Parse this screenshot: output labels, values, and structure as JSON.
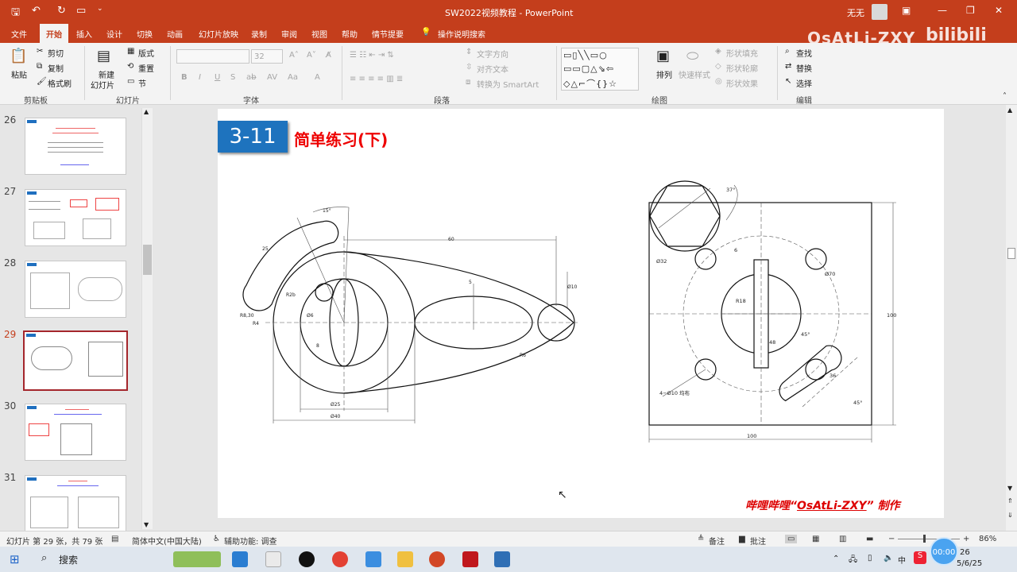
{
  "titlebar": {
    "doc_title": "SW2022视频教程  -  PowerPoint",
    "user": "无无"
  },
  "tabs": [
    "文件",
    "开始",
    "插入",
    "设计",
    "切换",
    "动画",
    "幻灯片放映",
    "录制",
    "审阅",
    "视图",
    "帮助",
    "情节提要",
    "操作说明搜索"
  ],
  "brand": {
    "text": "OsAtLi-ZXY",
    "logo": "bilibili"
  },
  "ribbon": {
    "clipboard": {
      "paste": "粘贴",
      "cut": "剪切",
      "copy": "复制",
      "format_painter": "格式刷",
      "group": "剪贴板"
    },
    "slides": {
      "new_slide": "新建",
      "new_slide2": "幻灯片",
      "layout": "版式",
      "reset": "重置",
      "section": "节",
      "group": "幻灯片"
    },
    "font": {
      "size": "32",
      "group": "字体"
    },
    "paragraph": {
      "text_direction": "文字方向",
      "align_text": "对齐文本",
      "smartart": "转换为 SmartArt",
      "group": "段落"
    },
    "drawing": {
      "arrange": "排列",
      "quick_styles": "快速样式",
      "shape_fill": "形状填充",
      "shape_outline": "形状轮廓",
      "shape_effects": "形状效果",
      "group": "绘图"
    },
    "editing": {
      "find": "查找",
      "replace": "替换",
      "select": "选择",
      "group": "编辑"
    }
  },
  "thumbnails": [
    {
      "num": "26",
      "selected": false
    },
    {
      "num": "27",
      "selected": false
    },
    {
      "num": "28",
      "selected": false
    },
    {
      "num": "29",
      "selected": true
    },
    {
      "num": "30",
      "selected": false
    },
    {
      "num": "31",
      "selected": false
    }
  ],
  "slide": {
    "badge": "3-11",
    "title": "简单练习(下)",
    "credit_prefix": "哔哩哔哩“",
    "credit_name": "OsAtLi-ZXY",
    "credit_suffix": "” 制作",
    "drawing1": {
      "d15": "15°",
      "d60": "60",
      "d25": "25",
      "r3": "R3",
      "r2b": "R2b",
      "d6": "Ø6",
      "d8": "8",
      "r8_30": "R8,30",
      "d_a": "R4",
      "r6": "R6",
      "d25b": "Ø25",
      "d40": "Ø40",
      "d10": "Ø10",
      "d5": "5"
    },
    "drawing2": {
      "a37": "37°",
      "d32": "Ø32",
      "d6": "6",
      "d70": "Ø70",
      "r18": "R18",
      "d48": "48",
      "a45a": "45°",
      "d100v": "100",
      "d36": "36",
      "a45b": "45°",
      "holes": "4−Ø10 均布",
      "d100h": "100"
    }
  },
  "status": {
    "slide_info": "幻灯片 第 29 张，共 79 张",
    "language": "简体中文(中国大陆)",
    "accessibility": "辅助功能: 调查",
    "notes": "备注",
    "comments": "批注",
    "zoom": "86%"
  },
  "taskbar": {
    "search": "搜索",
    "time": "00:00",
    "date_line1": "26",
    "date_line2": "5/6/25",
    "ime": "中"
  }
}
